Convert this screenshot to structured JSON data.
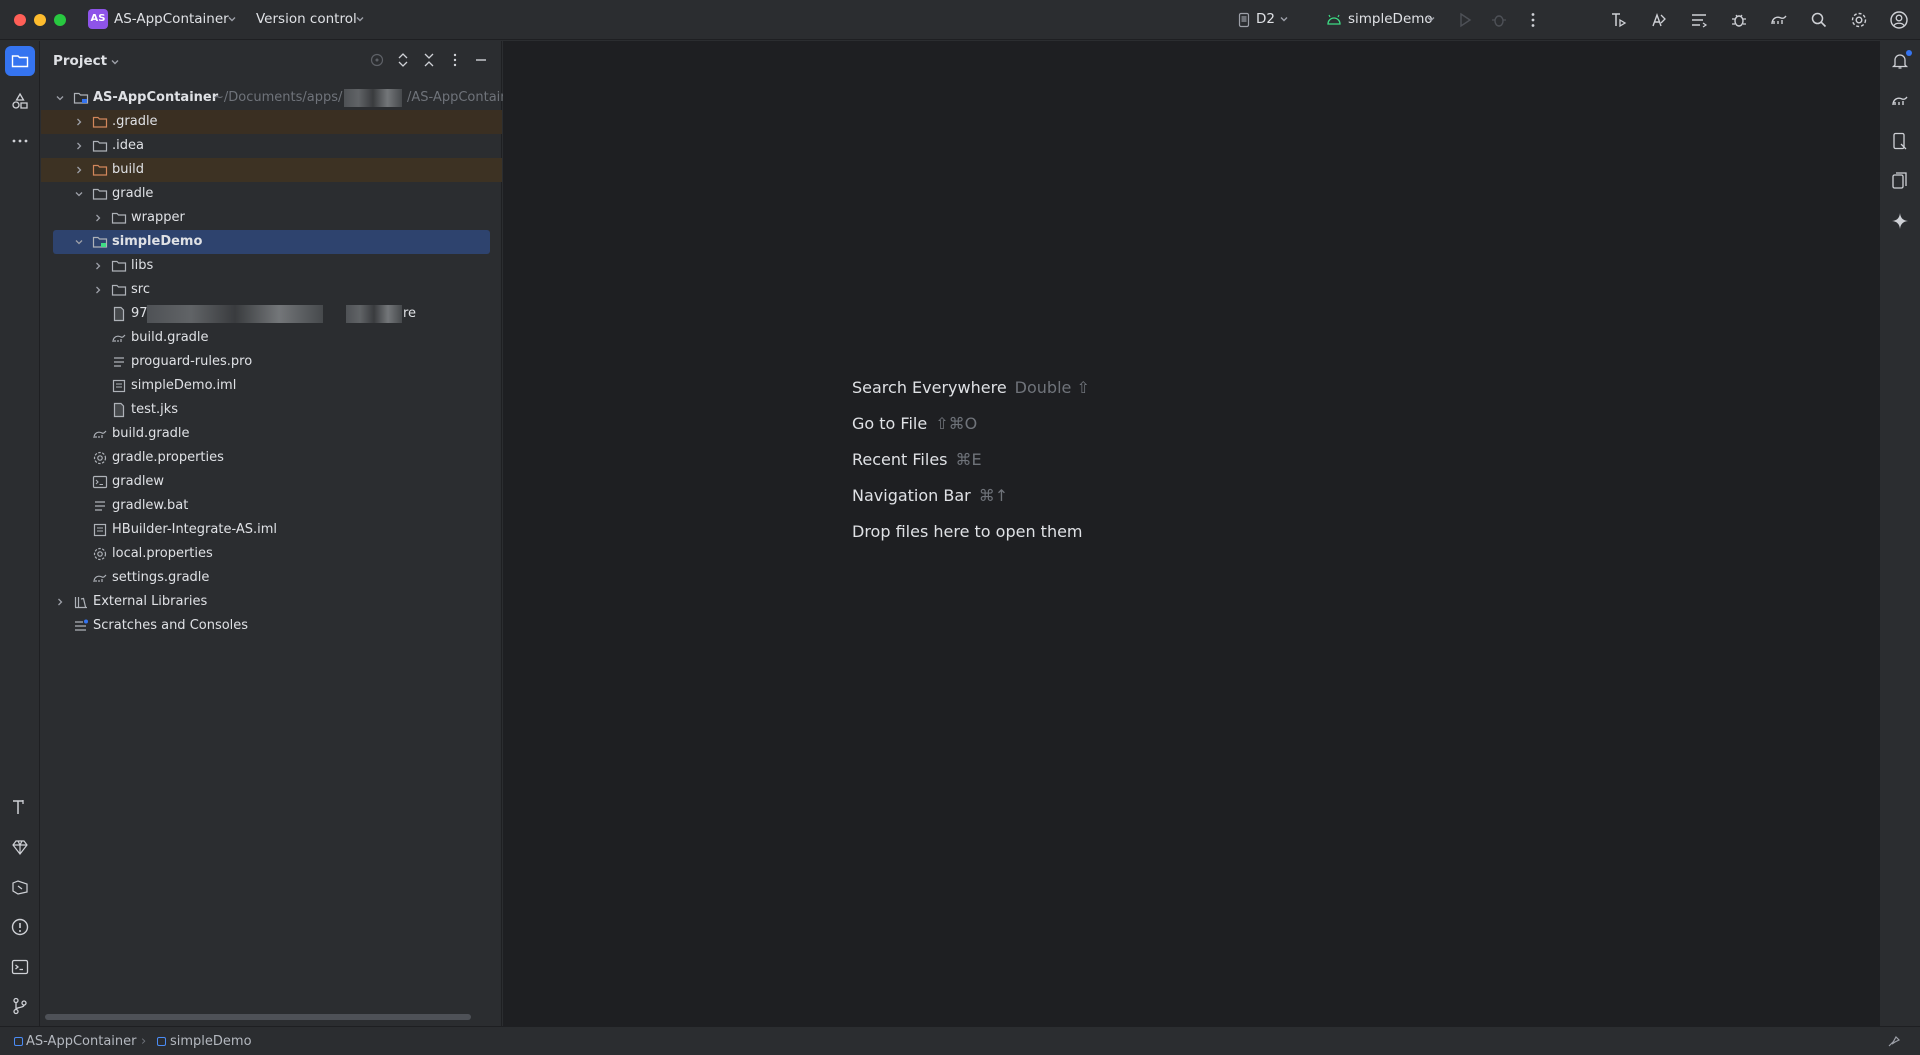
{
  "titlebar": {
    "project_badge": "AS",
    "project_name": "AS-AppContainer",
    "vcs_label": "Version control",
    "device": "D2",
    "run_config": "simpleDemo",
    "colors": {
      "badge": "#8e54e9",
      "android_green": "#3ddc84",
      "accent": "#3574f0"
    }
  },
  "project_panel": {
    "title": "Project",
    "tree": [
      {
        "label": "AS-AppContainer",
        "path_hint": "~/Documents/apps/",
        "path_tail": "/AS-AppContain",
        "icon": "module-folder-icon"
      },
      {
        "label": ".gradle",
        "icon": "excluded-folder-icon"
      },
      {
        "label": ".idea",
        "icon": "folder-icon"
      },
      {
        "label": "build",
        "icon": "excluded-folder-icon"
      },
      {
        "label": "gradle",
        "icon": "folder-icon"
      },
      {
        "label": "wrapper",
        "icon": "folder-icon"
      },
      {
        "label": "simpleDemo",
        "icon": "module-folder-icon"
      },
      {
        "label": "libs",
        "icon": "folder-icon"
      },
      {
        "label": "src",
        "icon": "folder-icon"
      },
      {
        "label_start": "97",
        "label_end": "re",
        "icon": "file-icon"
      },
      {
        "label": "build.gradle",
        "icon": "gradle-elephant-icon"
      },
      {
        "label": "proguard-rules.pro",
        "icon": "text-file-icon"
      },
      {
        "label": "simpleDemo.iml",
        "icon": "iml-file-icon"
      },
      {
        "label": "test.jks",
        "icon": "file-icon"
      },
      {
        "label": "build.gradle",
        "icon": "gradle-elephant-icon"
      },
      {
        "label": "gradle.properties",
        "icon": "properties-gear-icon"
      },
      {
        "label": "gradlew",
        "icon": "shell-script-icon"
      },
      {
        "label": "gradlew.bat",
        "icon": "text-file-icon"
      },
      {
        "label": "HBuilder-Integrate-AS.iml",
        "icon": "iml-file-icon"
      },
      {
        "label": "local.properties",
        "icon": "properties-gear-icon"
      },
      {
        "label": "settings.gradle",
        "icon": "gradle-elephant-icon"
      },
      {
        "label": "External Libraries",
        "icon": "library-icon"
      },
      {
        "label": "Scratches and Consoles",
        "icon": "scratches-icon"
      }
    ]
  },
  "editor": {
    "hints": [
      {
        "label": "Search Everywhere",
        "shortcut": "Double ⇧"
      },
      {
        "label": "Go to File",
        "shortcut": "⇧⌘O"
      },
      {
        "label": "Recent Files",
        "shortcut": "⌘E"
      },
      {
        "label": "Navigation Bar",
        "shortcut": "⌘↑"
      },
      {
        "label": "Drop files here to open them",
        "shortcut": ""
      }
    ]
  },
  "statusbar": {
    "breadcrumb": [
      "AS-AppContainer",
      "simpleDemo"
    ]
  }
}
